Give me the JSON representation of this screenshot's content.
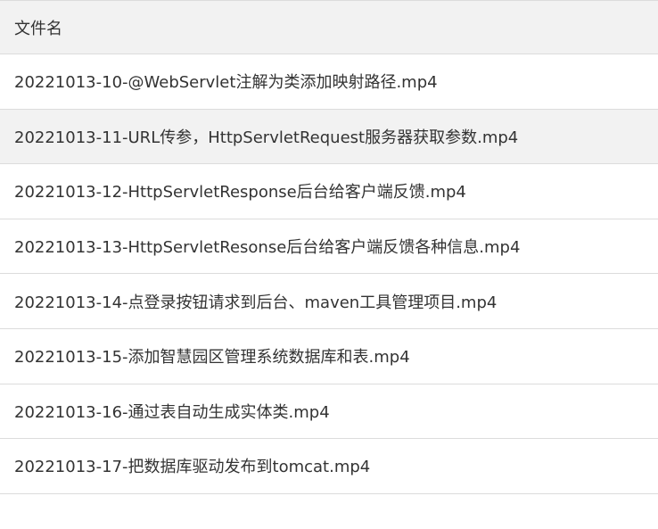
{
  "table": {
    "header": {
      "filename_label": "文件名"
    },
    "rows": [
      {
        "name": "20221013-10-@WebServlet注解为类添加映射路径.mp4",
        "highlighted": false
      },
      {
        "name": "20221013-11-URL传参，HttpServletRequest服务器获取参数.mp4",
        "highlighted": true
      },
      {
        "name": "20221013-12-HttpServletResponse后台给客户端反馈.mp4",
        "highlighted": false
      },
      {
        "name": "20221013-13-HttpServletResonse后台给客户端反馈各种信息.mp4",
        "highlighted": false
      },
      {
        "name": "20221013-14-点登录按钮请求到后台、maven工具管理项目.mp4",
        "highlighted": false
      },
      {
        "name": "20221013-15-添加智慧园区管理系统数据库和表.mp4",
        "highlighted": false
      },
      {
        "name": "20221013-16-通过表自动生成实体类.mp4",
        "highlighted": false
      },
      {
        "name": "20221013-17-把数据库驱动发布到tomcat.mp4",
        "highlighted": false
      }
    ]
  },
  "colors": {
    "header_background": "#f2f2f2",
    "row_highlight": "#f2f2f2",
    "border": "#dcdcdc",
    "text": "#333333"
  }
}
